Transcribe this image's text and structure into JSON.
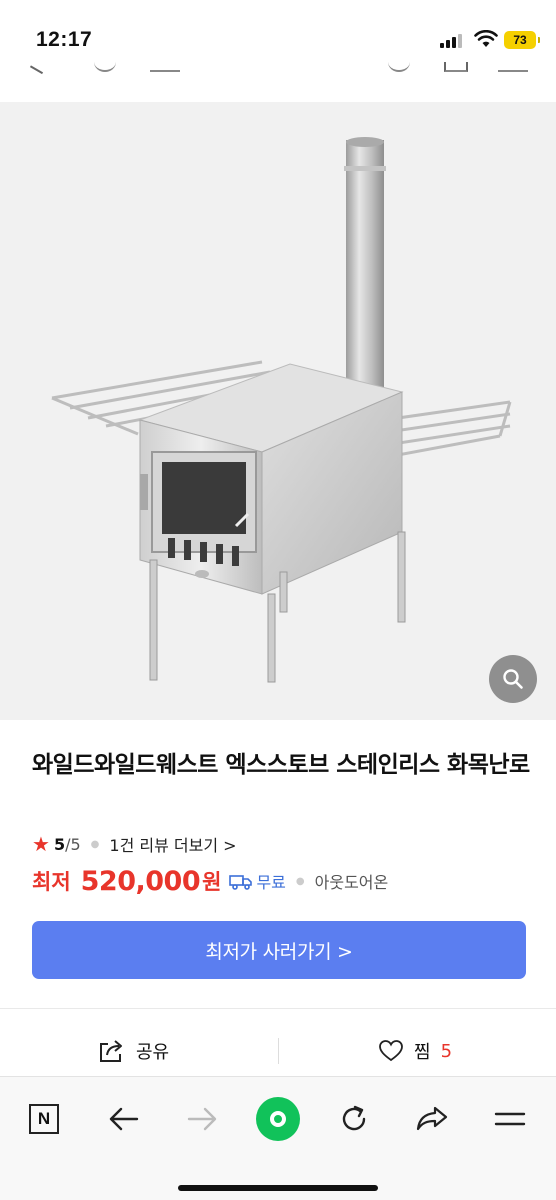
{
  "status_bar": {
    "time": "12:17",
    "battery": "73"
  },
  "product": {
    "title": "와일드와일드웨스트 엑스스토브 스테인리스 화목난로",
    "rating": {
      "value": "5",
      "max": "/5",
      "review_link": "1건 리뷰 더보기 >"
    },
    "price": {
      "label": "최저",
      "value": "520,000",
      "unit": "원"
    },
    "delivery": "무료",
    "seller": "아웃도어온",
    "cta_label": "최저가 사러가기 >"
  },
  "actions": {
    "share_label": "공유",
    "like_label": "찜",
    "like_count": "5"
  },
  "browser_bar": {
    "logo_letter": "N"
  },
  "colors": {
    "accent_red": "#e8352b",
    "cta_blue": "#5b7ef0",
    "delivery_blue": "#3c6fd8",
    "green": "#11c25a"
  },
  "icons": [
    "signal-icon",
    "wifi-icon",
    "battery-icon",
    "zoom-icon",
    "star-icon",
    "truck-icon",
    "share-icon",
    "heart-icon",
    "back-arrow-icon",
    "forward-arrow-icon",
    "refresh-icon",
    "share-arrow-icon",
    "menu-icon"
  ]
}
